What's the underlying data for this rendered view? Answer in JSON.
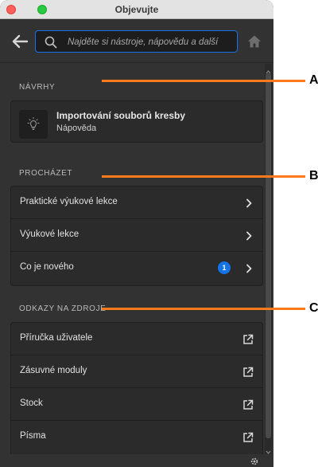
{
  "window": {
    "title": "Objevujte"
  },
  "search": {
    "placeholder": "Najděte si nástroje, nápovědu a další"
  },
  "suggestions": {
    "heading": "NÁVRHY",
    "item": {
      "title": "Importování souborů kresby",
      "subtitle": "Nápověda",
      "icon": "lightbulb-icon"
    }
  },
  "browse": {
    "heading": "PROCHÁZET",
    "items": [
      {
        "label": "Praktické výukové lekce",
        "badge": ""
      },
      {
        "label": "Výukové lekce",
        "badge": ""
      },
      {
        "label": "Co je nového",
        "badge": "1"
      }
    ]
  },
  "resources": {
    "heading": "ODKAZY NA ZDROJE",
    "items": [
      {
        "label": "Příručka uživatele"
      },
      {
        "label": "Zásuvné moduly"
      },
      {
        "label": "Stock"
      },
      {
        "label": "Písma"
      }
    ]
  },
  "callouts": [
    "A",
    "B",
    "C"
  ],
  "colors": {
    "accent": "#1473e6",
    "callout_line": "#ff7a1a",
    "panel_bg": "#323232"
  }
}
